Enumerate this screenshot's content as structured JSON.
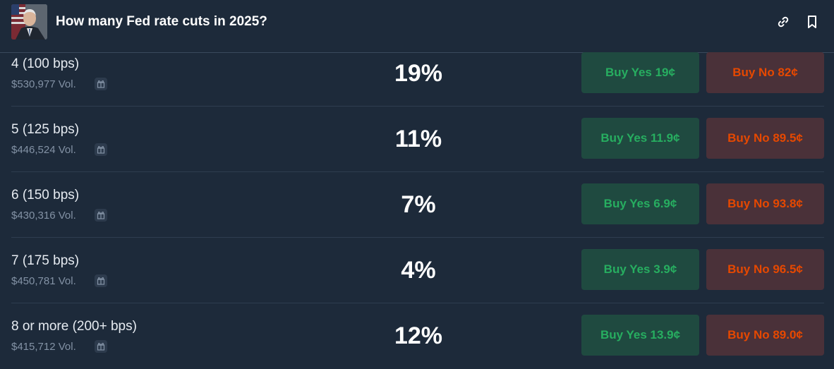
{
  "header": {
    "title": "How many Fed rate cuts in 2025?",
    "avatar_alt": "",
    "icons": [
      "link-icon",
      "bookmark-icon"
    ]
  },
  "rows": [
    {
      "outcome": "4 (100 bps)",
      "volume": "$530,977 Vol.",
      "percent": "19%",
      "buy_yes": "Buy Yes 19¢",
      "buy_no": "Buy No 82¢"
    },
    {
      "outcome": "5 (125 bps)",
      "volume": "$446,524 Vol.",
      "percent": "11%",
      "buy_yes": "Buy Yes 11.9¢",
      "buy_no": "Buy No 89.5¢"
    },
    {
      "outcome": "6 (150 bps)",
      "volume": "$430,316 Vol.",
      "percent": "7%",
      "buy_yes": "Buy Yes 6.9¢",
      "buy_no": "Buy No 93.8¢"
    },
    {
      "outcome": "7 (175 bps)",
      "volume": "$450,781 Vol.",
      "percent": "4%",
      "buy_yes": "Buy Yes 3.9¢",
      "buy_no": "Buy No 96.5¢"
    },
    {
      "outcome": "8 or more (200+ bps)",
      "volume": "$415,712 Vol.",
      "percent": "12%",
      "buy_yes": "Buy Yes 13.9¢",
      "buy_no": "Buy No 89.0¢"
    }
  ],
  "colors": {
    "background": "#1d2a3a",
    "yes_text": "#27ae60",
    "yes_bg": "#1f4a40",
    "no_text": "#e64800",
    "no_bg": "#4a3139",
    "muted": "#8392a5"
  }
}
